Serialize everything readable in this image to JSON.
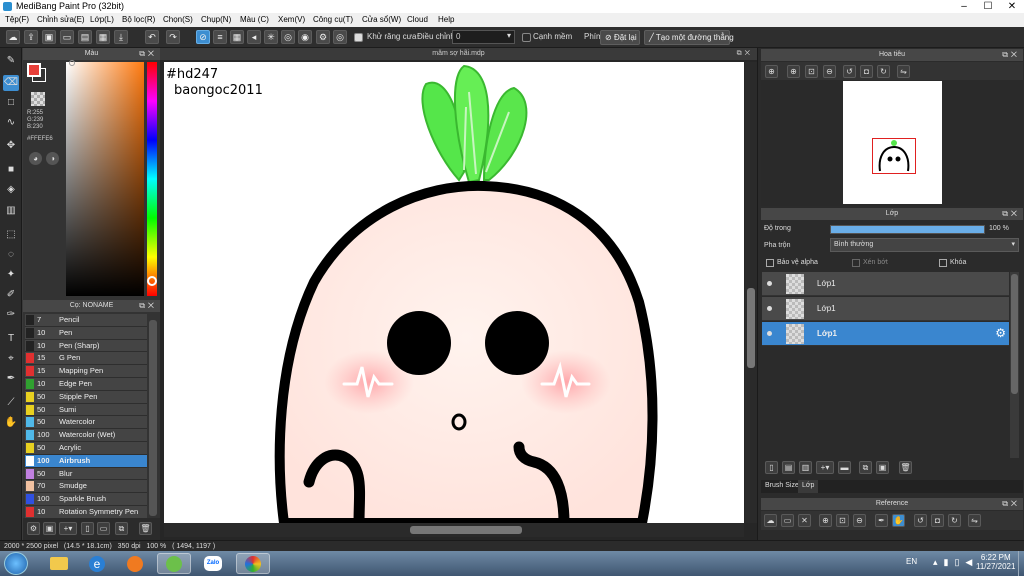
{
  "window": {
    "title": "MediBang Paint Pro (32bit)"
  },
  "menu": [
    "Tệp(F)",
    "Chỉnh sửa(E)",
    "Lớp(L)",
    "Bộ lọc(R)",
    "Chọn(S)",
    "Chụp(N)",
    "Màu (C)",
    "Xem(V)",
    "Công cụ(T)",
    "Cửa sổ(W)",
    "Cloud",
    "Help"
  ],
  "toolbar": {
    "antialias_label": "Khử răng cưa",
    "adjust_label": "Điều chỉnh",
    "adjust_value": "0",
    "edge_label": "Cạnh mềm",
    "key_label": "Phím",
    "reset_label": "Đặt lại",
    "straight_line_label": "Tạo một đường thẳng"
  },
  "color_panel": {
    "title": "Màu",
    "rgb_r": "R:255",
    "rgb_g": "G:239",
    "rgb_b": "B:230",
    "hex": "#FFEFE6",
    "fg_color": "#e8403a",
    "bg_color": "#ffffff"
  },
  "brush_panel": {
    "title": "Cọ: NONAME",
    "items": [
      {
        "size": "7",
        "name": "Pencil",
        "color": "#222222"
      },
      {
        "size": "10",
        "name": "Pen",
        "color": "#222222"
      },
      {
        "size": "10",
        "name": "Pen (Sharp)",
        "color": "#222222"
      },
      {
        "size": "15",
        "name": "G Pen",
        "color": "#e03030"
      },
      {
        "size": "15",
        "name": "Mapping Pen",
        "color": "#e03030"
      },
      {
        "size": "10",
        "name": "Edge Pen",
        "color": "#30a030"
      },
      {
        "size": "50",
        "name": "Stipple Pen",
        "color": "#e8d020"
      },
      {
        "size": "50",
        "name": "Sumi",
        "color": "#e8d020"
      },
      {
        "size": "50",
        "name": "Watercolor",
        "color": "#50b8e8"
      },
      {
        "size": "100",
        "name": "Watercolor (Wet)",
        "color": "#50b8e8"
      },
      {
        "size": "50",
        "name": "Acrylic",
        "color": "#e8d020"
      },
      {
        "size": "100",
        "name": "Airbrush",
        "color": "#ffffff"
      },
      {
        "size": "50",
        "name": "Blur",
        "color": "#c080e0"
      },
      {
        "size": "70",
        "name": "Smudge",
        "color": "#f0c0a0"
      },
      {
        "size": "100",
        "name": "Sparkle Brush",
        "color": "#3050e0"
      },
      {
        "size": "10",
        "name": "Rotation Symmetry Pen",
        "color": "#e03030"
      }
    ],
    "selected_index": 11
  },
  "document": {
    "tab_title": "măm sợ hãi.mdp",
    "text_line1": "#hd247",
    "text_line2": "baongoc2011"
  },
  "navigator": {
    "title": "Hoa tiêu"
  },
  "layer_panel": {
    "title": "Lớp",
    "opacity_label": "Độ trong",
    "opacity_value": "100 %",
    "opacity_fraction": 1.0,
    "blend_label": "Pha trộn",
    "blend_value": "Bình thường",
    "protect_alpha": "Bảo vệ alpha",
    "clipping": "Xén bớt",
    "lock": "Khóa",
    "layers": [
      {
        "name": "Lớp1"
      },
      {
        "name": "Lớp1"
      },
      {
        "name": "Lớp1"
      }
    ],
    "tab_brush_size": "Brush Size",
    "tab_layer": "Lớp"
  },
  "reference": {
    "title": "Reference"
  },
  "status": {
    "info": "2000 * 2500 pixel   (14.5 * 18.1cm)   350 dpi   100 %   ( 1494, 1197 )"
  },
  "taskbar": {
    "lang": "EN",
    "time": "6:22 PM",
    "date": "11/27/2021",
    "zalo": "Zalo"
  }
}
